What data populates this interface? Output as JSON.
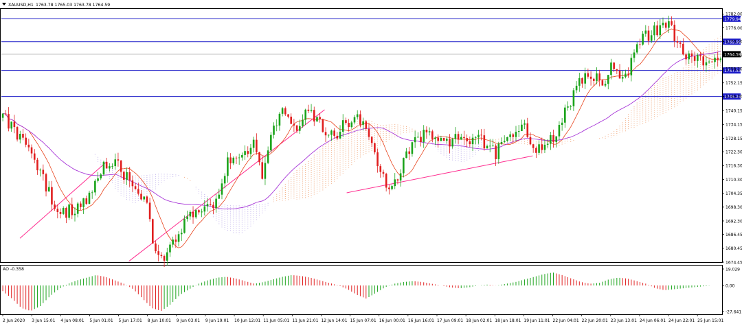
{
  "header": {
    "symbol_label": "XAUUSD,H1",
    "ohlc_label": "1763.78 1765.03 1763.78 1764.59"
  },
  "colors": {
    "bull": "#1aa31a",
    "bear": "#e01e1e",
    "level_line": "#1c1cc8",
    "level_label_bg": "#1c1cc8",
    "price_label_bg": "#000000",
    "ma_fast": "#e8431c",
    "ma_slow": "#a838d8",
    "trendline": "#ff2e90",
    "cloud": "#f0a070",
    "cloud_alt": "#b8a8e8",
    "ao_up": "#1aa31a",
    "ao_down": "#e01e1e",
    "grid": "#000000"
  },
  "chart_data": [
    {
      "type": "candlestick",
      "title": "XAUUSD,H1",
      "ylim": [
        1674.45,
        1784.5
      ],
      "y_ticks": [
        "1782.00",
        "1776.00",
        "1770.10",
        "1764.15",
        "1758.20",
        "1752.15",
        "1746.30",
        "1740.15",
        "1734.15",
        "1728.15",
        "1722.30",
        "1716.30",
        "1710.30",
        "1704.35",
        "1698.30",
        "1692.30",
        "1686.45",
        "1680.45",
        "1674.45"
      ],
      "x_ticks": [
        "2 Jun 2020",
        "3 Jun 15:01",
        "4 Jun 08:01",
        "5 Jun 01:01",
        "5 Jun 17:01",
        "8 Jun 10:01",
        "9 Jun 03:01",
        "9 Jun 19:01",
        "10 Jun 12:01",
        "11 Jun 05:01",
        "11 Jun 21:01",
        "12 Jun 14:01",
        "15 Jun 07:01",
        "16 Jun 00:01",
        "16 Jun 16:01",
        "17 Jun 09:01",
        "18 Jun 02:01",
        "18 Jun 18:01",
        "19 Jun 11:01",
        "22 Jun 04:01",
        "22 Jun 20:01",
        "23 Jun 13:01",
        "24 Jun 06:01",
        "24 Jun 22:01",
        "25 Jun 15:01"
      ],
      "horizontal_levels": [
        {
          "value": 1779.94,
          "label": "1779.94"
        },
        {
          "value": 1769.99,
          "label": "1769.99"
        },
        {
          "value": 1757.53,
          "label": "1757.53"
        },
        {
          "value": 1746.23,
          "label": "1746.23"
        }
      ],
      "current_price": {
        "value": 1764.59,
        "label": "1764.59"
      },
      "anchors": [
        1737,
        1734,
        1727,
        1722,
        1716,
        1706,
        1693,
        1696,
        1698,
        1700,
        1704,
        1714,
        1719,
        1715,
        1711,
        1705,
        1700,
        1679,
        1678,
        1683,
        1690,
        1696,
        1699,
        1698,
        1702,
        1718,
        1720,
        1722,
        1726,
        1712,
        1733,
        1739,
        1735,
        1733,
        1743,
        1736,
        1730,
        1728,
        1734,
        1737,
        1735,
        1729,
        1716,
        1706,
        1712,
        1722,
        1728,
        1730,
        1729,
        1728,
        1727,
        1730,
        1727,
        1729,
        1725,
        1721,
        1728,
        1729,
        1733,
        1726,
        1722,
        1727,
        1732,
        1742,
        1750,
        1758,
        1755,
        1748,
        1762,
        1752,
        1760,
        1770,
        1773,
        1776,
        1779,
        1772,
        1765,
        1762,
        1761,
        1763,
        1765
      ],
      "trendlines": [
        {
          "from": [
            "2 Jun 2020",
            1684.8
          ],
          "to": [
            "5 Jun 01:01",
            1718.0
          ]
        },
        {
          "from": [
            "5 Jun 17:01",
            1674.8
          ],
          "to": [
            "12 Jun 14:01",
            1740.5
          ]
        },
        {
          "from": [
            "15 Jun 07:01",
            1704.5
          ],
          "to": [
            "18 Jun 18:01",
            1720.5
          ]
        }
      ],
      "indicators": [
        "Ichimoku cloud",
        "Moving average (fast)",
        "Moving average (slow)"
      ]
    },
    {
      "type": "bar",
      "title": "AO -0.358",
      "ylim": [
        -27.641,
        19.029
      ],
      "y_ticks": [
        "19.029",
        "0.00",
        "-27.641"
      ],
      "anchors": [
        -6,
        -14,
        -24,
        -27,
        -22,
        -12,
        -4,
        2,
        6,
        9,
        12,
        10,
        6,
        2,
        -4,
        -14,
        -24,
        -27,
        -20,
        -10,
        -4,
        2,
        6,
        9,
        10,
        8,
        5,
        2,
        4,
        7,
        10,
        12,
        11,
        9,
        6,
        3,
        0,
        -4,
        -10,
        -14,
        -8,
        -2,
        2,
        4,
        5,
        4,
        2,
        0,
        -2,
        -3,
        -2,
        0,
        1,
        0,
        2,
        4,
        7,
        10,
        13,
        15,
        12,
        8,
        4,
        2,
        3,
        7,
        9,
        8,
        5,
        2,
        -3,
        -5,
        -4,
        -3,
        -2,
        -1,
        0,
        0
      ]
    }
  ]
}
